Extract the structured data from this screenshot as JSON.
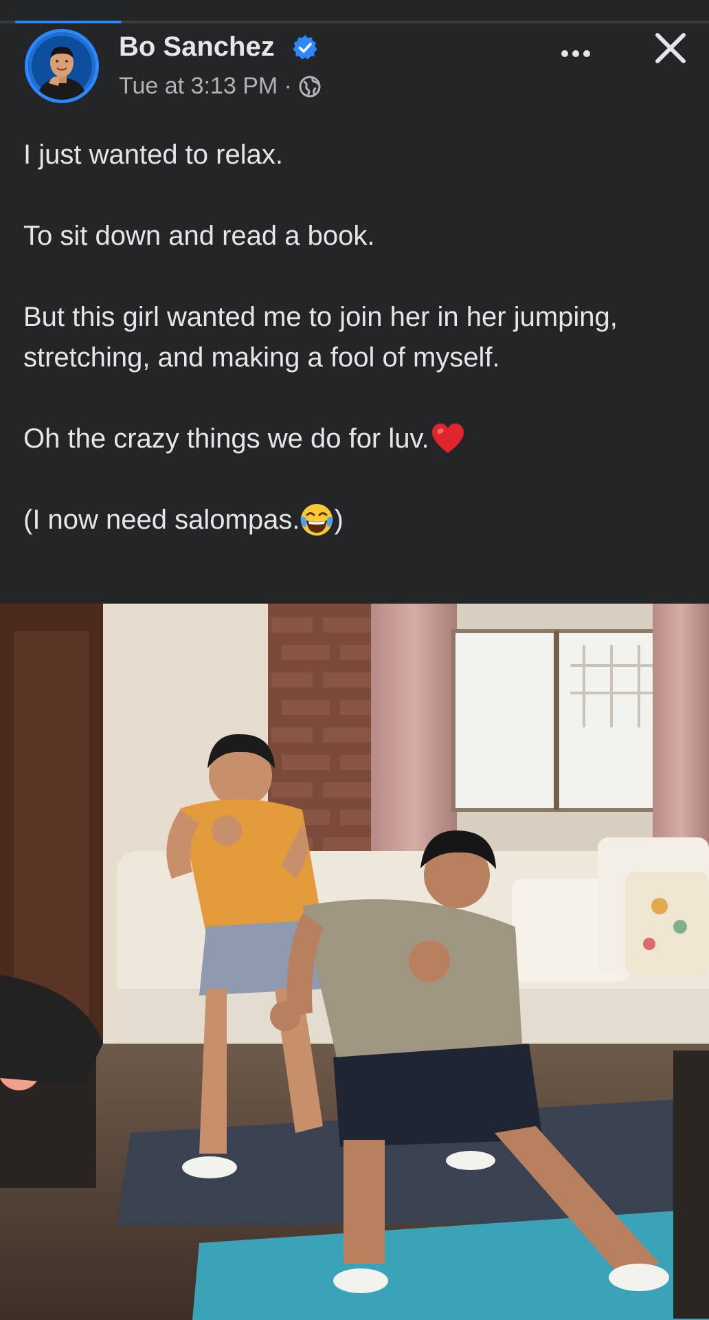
{
  "post": {
    "author_name": "Bo Sanchez",
    "timestamp": "Tue at 3:13 PM ·",
    "privacy_icon": "globe-icon",
    "verified_icon": "verified-badge-icon",
    "more_icon": "more-options-icon",
    "close_icon": "close-icon",
    "viewer_progress": 0.15,
    "text": {
      "line1": "I just wanted to relax.",
      "line2": "To sit down and read a book.",
      "line3": "But this girl wanted me to join her in her jumping, stretching, and making a fool of myself.",
      "line4": "Oh the crazy things we do for luv.",
      "line4_emoji": "red-heart-emoji",
      "line5_start": "(I now need salompas.",
      "line5_emoji": "face-with-tears-of-joy-emoji",
      "line5_end": ")"
    },
    "photo": {
      "subject": "photo of a man and a woman doing a stretching exercise in a living room"
    }
  },
  "colors": {
    "background": "#242526",
    "text_primary": "#e4e6eb",
    "text_secondary": "#b0b3b8",
    "accent_blue": "#2d88ff",
    "heart_red": "#e0252f"
  }
}
